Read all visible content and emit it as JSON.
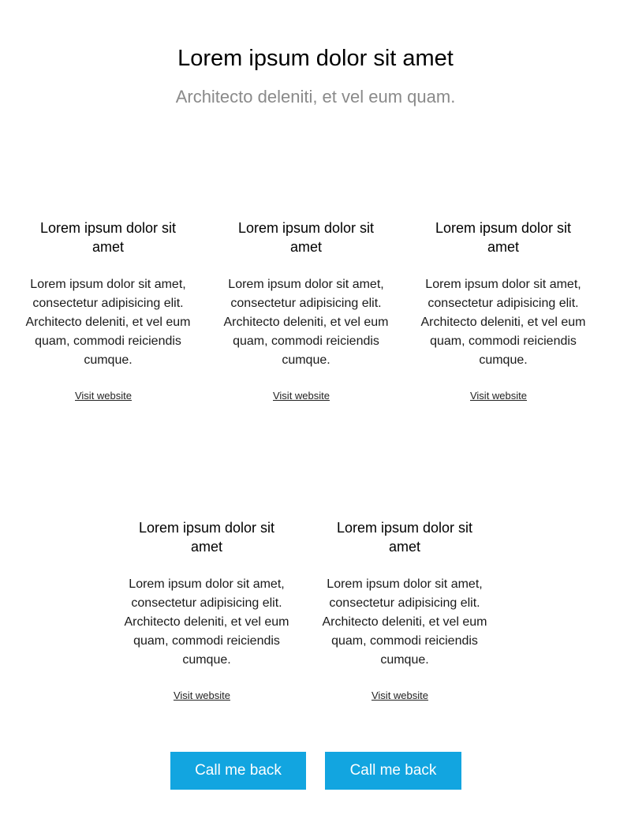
{
  "hero": {
    "title": "Lorem ipsum dolor sit amet",
    "subtitle": "Architecto deleniti, et vel eum quam."
  },
  "cards": [
    {
      "title": "Lorem ipsum dolor sit amet",
      "text": "Lorem ipsum dolor sit amet, consectetur adipisicing elit. Architecto deleniti, et vel eum quam, commodi reiciendis cumque.",
      "link_label": "Visit website"
    },
    {
      "title": "Lorem ipsum dolor sit amet",
      "text": "Lorem ipsum dolor sit amet, consectetur adipisicing elit. Architecto deleniti, et vel eum quam, commodi reiciendis cumque.",
      "link_label": "Visit website"
    },
    {
      "title": "Lorem ipsum dolor sit amet",
      "text": "Lorem ipsum dolor sit amet, consectetur adipisicing elit. Architecto deleniti, et vel eum quam, commodi reiciendis cumque.",
      "link_label": "Visit website"
    },
    {
      "title": "Lorem ipsum dolor sit amet",
      "text": "Lorem ipsum dolor sit amet, consectetur adipisicing elit. Architecto deleniti, et vel eum quam, commodi reiciendis cumque.",
      "link_label": "Visit website"
    },
    {
      "title": "Lorem ipsum dolor sit amet",
      "text": "Lorem ipsum dolor sit amet, consectetur adipisicing elit. Architecto deleniti, et vel eum quam, commodi reiciendis cumque.",
      "link_label": "Visit website"
    }
  ],
  "cta": {
    "buttons": [
      {
        "label": "Call me back"
      },
      {
        "label": "Call me back"
      }
    ],
    "color": "#12a5e0"
  }
}
